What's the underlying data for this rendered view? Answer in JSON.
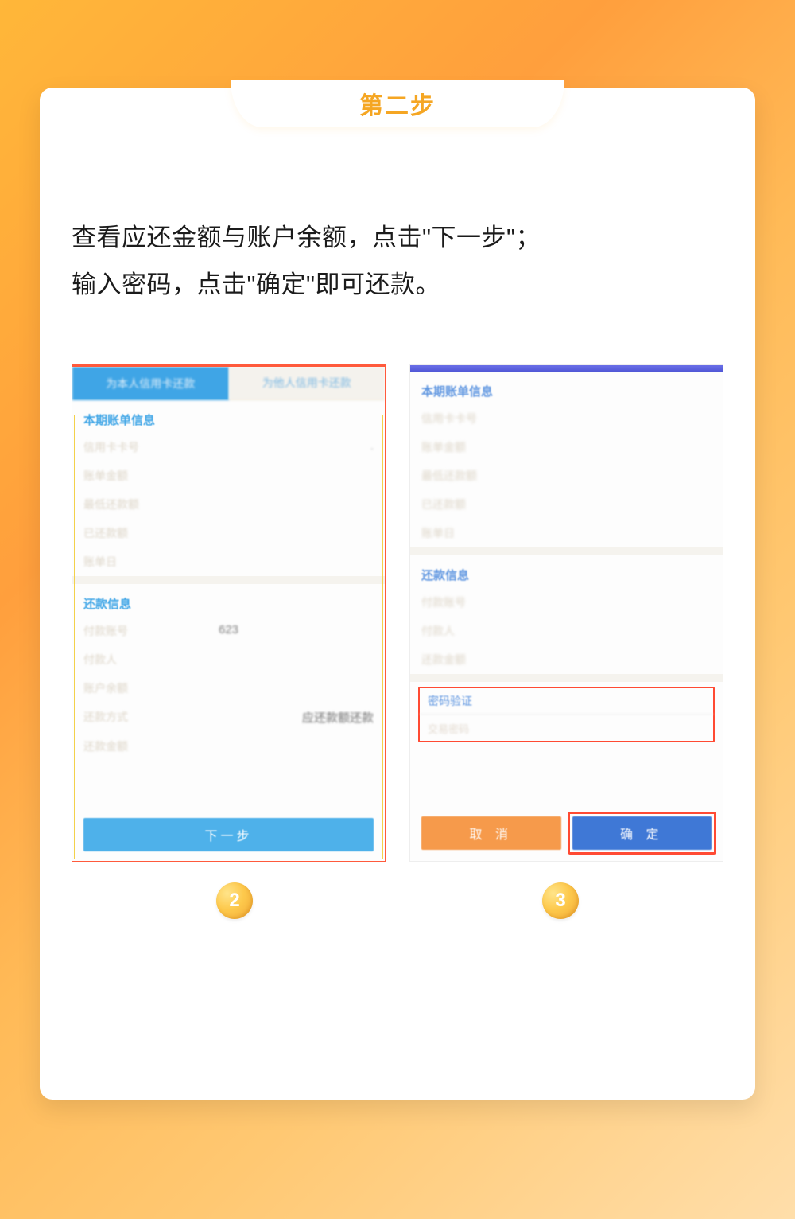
{
  "step_title": "第二步",
  "instruction_line1": "查看应还金额与账户余额，点击\"下一步\"；",
  "instruction_line2": "输入密码，点击\"确定\"即可还款。",
  "left": {
    "tab_active": "为本人信用卡还款",
    "tab_inactive": "为他人信用卡还款",
    "section1_title": "本期账单信息",
    "rows1": {
      "r1": "信用卡卡号",
      "r2": "账单金额",
      "r3": "最低还款额",
      "r4": "已还款额",
      "r5": "账单日"
    },
    "section2_title": "还款信息",
    "rows2": {
      "pay_account_label": "付款账号",
      "pay_account_value": "623",
      "payer_label": "付款人",
      "balance_label": "账户余额",
      "method_label": "还款方式",
      "method_value": "应还款额还款",
      "amount_label": "还款金额"
    },
    "button": "下一步"
  },
  "right": {
    "section1_title": "本期账单信息",
    "rows1": {
      "r1": "信用卡卡号",
      "r2": "账单金额",
      "r3": "最低还款额",
      "r4": "已还款额",
      "r5": "账单日"
    },
    "section2_title": "还款信息",
    "rows2": {
      "r1": "付款账号",
      "r2": "付款人",
      "r3": "还款金额"
    },
    "pwd_title": "密码验证",
    "pwd_field": "交易密码",
    "cancel": "取 消",
    "confirm": "确 定"
  },
  "badges": {
    "left": "2",
    "right": "3"
  }
}
